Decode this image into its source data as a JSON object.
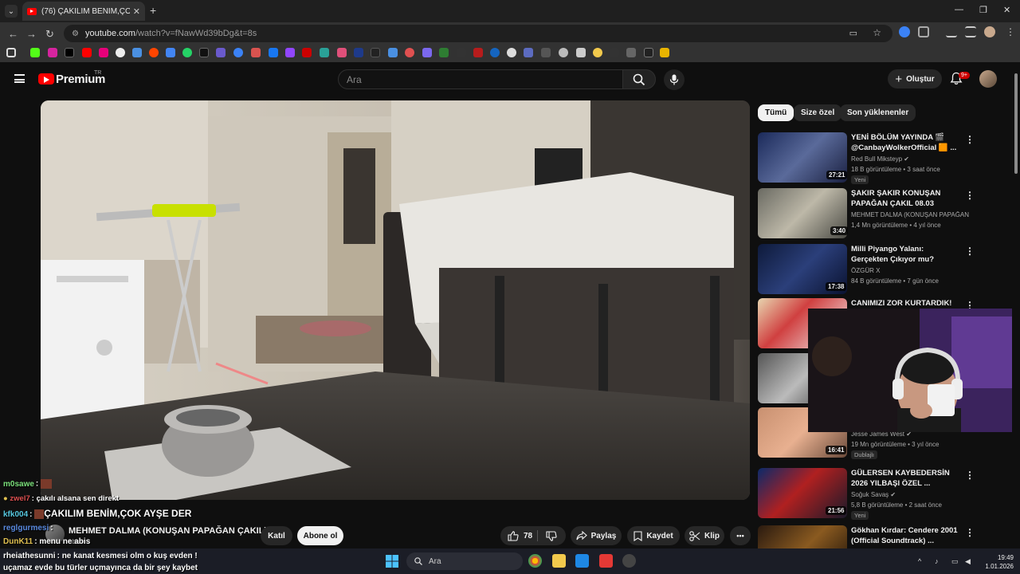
{
  "browser": {
    "tab_title": "(76) ÇAKILIM BENİM,ÇOK AYŞE",
    "tab_close": "✕",
    "new_tab": "+",
    "url_host": "youtube.com",
    "url_path": "/watch?v=fNawWd39bDg&t=8s"
  },
  "youtube": {
    "brand": "Premium",
    "region": "TR",
    "search_placeholder": "Ara",
    "create_label": "Oluştur",
    "notifications_badge": "9+"
  },
  "video": {
    "channel_name": "MEHMET DALMA (KONUŞAN PAPAĞAN ÇAKIL)",
    "subscribers": "abone",
    "join_label": "Katıl",
    "subscribe_label": "Abone ol",
    "likes": "78",
    "share_label": "Paylaş",
    "save_label": "Kaydet",
    "clip_label": "Klip",
    "more_label": "•••"
  },
  "chips": [
    "Tümü",
    "Size özel",
    "Son yüklenenler"
  ],
  "recommendations": [
    {
      "title": "YENİ BÖLÜM YAYINDA 🎬 @CanbayWolkerOfficial 🟧 ...",
      "channel": "Red Bull Miksteyp ✔",
      "meta": "18 B görüntüleme • 3 saat önce",
      "badge": "Yeni",
      "duration": "27:21"
    },
    {
      "title": "ŞAKIR ŞAKIR KONUŞAN PAPAĞAN ÇAKIL 08.03",
      "channel": "MEHMET DALMA (KONUŞAN PAPAĞAN ...",
      "meta": "1,4 Mn görüntüleme • 4 yıl önce",
      "badge": "",
      "duration": "3:40"
    },
    {
      "title": "Milli Piyango Yalanı: Gerçekten Çıkıyor mu?",
      "channel": "ÖZGÜR X",
      "meta": "84 B görüntüleme • 7 gün önce",
      "badge": "",
      "duration": "17:38"
    },
    {
      "title": "CANIMIZI ZOR KURTARDIK! 😱",
      "channel": "",
      "meta": "",
      "badge": "",
      "duration": ""
    },
    {
      "title": "",
      "channel": "",
      "meta": "",
      "badge": "",
      "duration": ""
    },
    {
      "title": "",
      "channel": "Jesse James West ✔",
      "meta": "19 Mn görüntüleme • 3 yıl önce",
      "badge": "Dublajlı",
      "duration": "16:41"
    },
    {
      "title": "GÜLERSEN KAYBEDERSİN 2026 YILBAŞI ÖZEL ...",
      "channel": "Soğuk Savaş ✔",
      "meta": "5,8 B görüntüleme • 2 saat önce",
      "badge": "Yeni",
      "duration": "21:56"
    },
    {
      "title": "Gökhan Kırdar: Cendere 2001 (Official Soundtrack) ...",
      "channel": "",
      "meta": "",
      "badge": "",
      "duration": ""
    }
  ],
  "chat": [
    {
      "user": "m0sawe",
      "user_color": "#7be07b",
      "msg": ""
    },
    {
      "user": "zwel7",
      "user_color": "#e05050",
      "msg": "çakılı alsana sen direkt"
    },
    {
      "user": "kfk004",
      "user_color": "#56c8e0",
      "msg": "ÇAKILIM BENİM,ÇOK AYŞE DER"
    },
    {
      "user": "reglgurmesi",
      "user_color": "#5a8ae0",
      "msg": ""
    },
    {
      "user": "DunK11",
      "user_color": "#e0c050",
      "msg": "menu ne abis"
    },
    {
      "user": "rheiathesunni",
      "user_color": "#ffffff",
      "msg": "ne kanat kesmesi olm o kuş evden !"
    },
    {
      "user": "",
      "user_color": "#ffffff",
      "msg": "uçamaz evde bu türler uçmayınca da bir şey kaybet"
    }
  ],
  "taskbar": {
    "search_placeholder": "Ara",
    "time": "19:49",
    "date": "1.01.2026"
  }
}
